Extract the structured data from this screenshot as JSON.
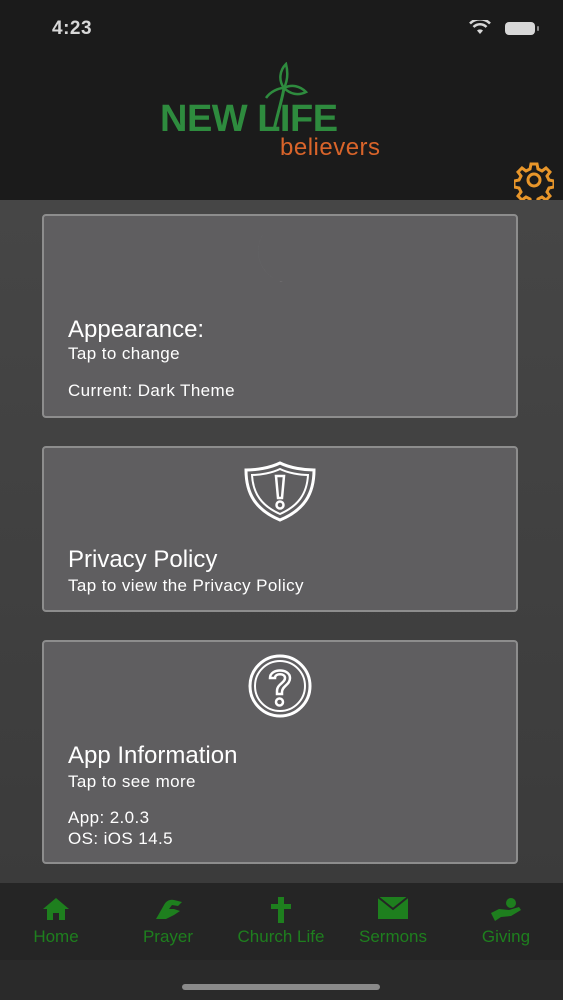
{
  "status_bar": {
    "time": "4:23"
  },
  "header": {
    "logo_main": "NEW LIFE",
    "logo_sub": "believers"
  },
  "cards": [
    {
      "icon": "moon-icon",
      "title": "Appearance:",
      "subtitle": "Tap to change",
      "detail": "Current: Dark Theme"
    },
    {
      "icon": "shield-alert-icon",
      "title": "Privacy Policy",
      "subtitle": "Tap to view the Privacy Policy"
    },
    {
      "icon": "question-icon",
      "title": "App Information",
      "subtitle": "Tap to see more",
      "app_version": "App: 2.0.3",
      "os_version": "OS: iOS 14.5"
    }
  ],
  "tabs": [
    {
      "label": "Home",
      "icon": "home-icon"
    },
    {
      "label": "Prayer",
      "icon": "praying-hands-icon"
    },
    {
      "label": "Church Life",
      "icon": "cross-icon"
    },
    {
      "label": "Sermons",
      "icon": "envelope-icon"
    },
    {
      "label": "Giving",
      "icon": "giving-hand-icon"
    }
  ],
  "colors": {
    "logo_green": "#2e8b3e",
    "logo_orange": "#d9642a",
    "gear": "#e8962a",
    "tab_green": "#1e7f1e",
    "card_bg": "#5f5e60"
  }
}
